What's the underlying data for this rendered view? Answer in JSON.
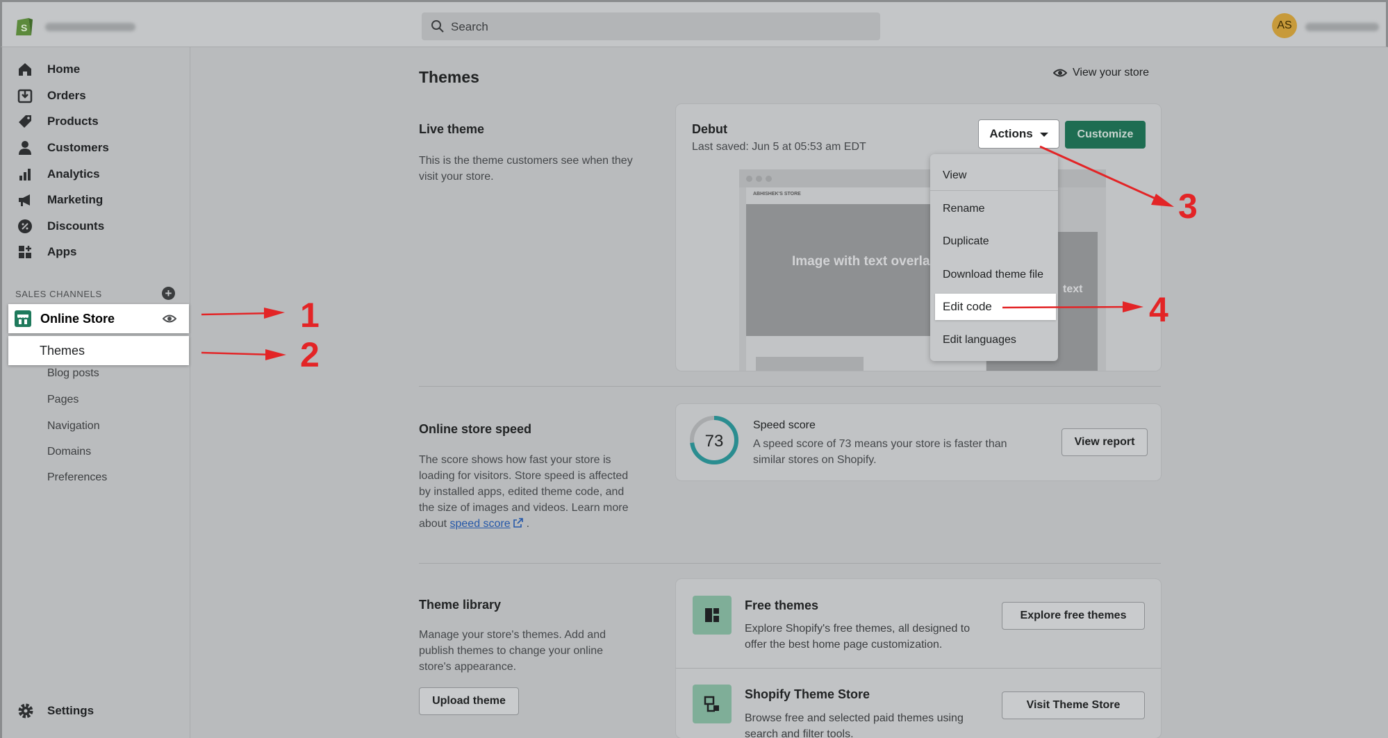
{
  "topbar": {
    "search_placeholder": "Search",
    "avatar_initials": "AS"
  },
  "sidebar": {
    "items": [
      {
        "label": "Home",
        "icon": "home-icon"
      },
      {
        "label": "Orders",
        "icon": "orders-icon"
      },
      {
        "label": "Products",
        "icon": "tag-icon"
      },
      {
        "label": "Customers",
        "icon": "person-icon"
      },
      {
        "label": "Analytics",
        "icon": "bar-chart-icon"
      },
      {
        "label": "Marketing",
        "icon": "megaphone-icon"
      },
      {
        "label": "Discounts",
        "icon": "discount-icon"
      },
      {
        "label": "Apps",
        "icon": "apps-icon"
      }
    ],
    "section_label": "SALES CHANNELS",
    "online_store_label": "Online Store",
    "sub_items": [
      "Themes",
      "Blog posts",
      "Pages",
      "Navigation",
      "Domains",
      "Preferences"
    ],
    "settings_label": "Settings"
  },
  "page": {
    "title": "Themes",
    "view_store_label": "View your store"
  },
  "live_theme": {
    "title": "Live theme",
    "description": "This is the theme customers see when they visit your store.",
    "theme_name": "Debut",
    "last_saved": "Last saved: Jun 5 at 05:53 am EDT",
    "actions_label": "Actions",
    "customize_label": "Customize",
    "preview": {
      "brand": "ABHISHEK'S STORE",
      "hero_text": "Image with text overla",
      "side_text": "text"
    },
    "actions_menu": [
      "View",
      "Rename",
      "Duplicate",
      "Download theme file",
      "Edit code",
      "Edit languages"
    ]
  },
  "speed": {
    "title": "Online store speed",
    "description": "The score shows how fast your store is loading for visitors. Store speed is affected by installed apps, edited theme code, and the size of images and videos. Learn more about",
    "link_text": "speed score",
    "link_suffix": ".",
    "score": "73",
    "score_fraction": 0.73,
    "card_title": "Speed score",
    "card_text": "A speed score of 73 means your store is faster than similar stores on Shopify.",
    "view_report_label": "View report"
  },
  "library": {
    "title": "Theme library",
    "description": "Manage your store's themes. Add and publish themes to change your online store's appearance.",
    "upload_label": "Upload theme",
    "free_title": "Free themes",
    "free_text": "Explore Shopify's free themes, all designed to offer the best home page customization.",
    "explore_label": "Explore free themes",
    "store_title": "Shopify Theme Store",
    "store_text": "Browse free and selected paid themes using search and filter tools.",
    "visit_label": "Visit Theme Store"
  },
  "annotations": [
    "1",
    "2",
    "3",
    "4"
  ],
  "colors": {
    "accent_green": "#1e6d52",
    "annotation_red": "#e32426",
    "link_blue": "#2457a8"
  }
}
